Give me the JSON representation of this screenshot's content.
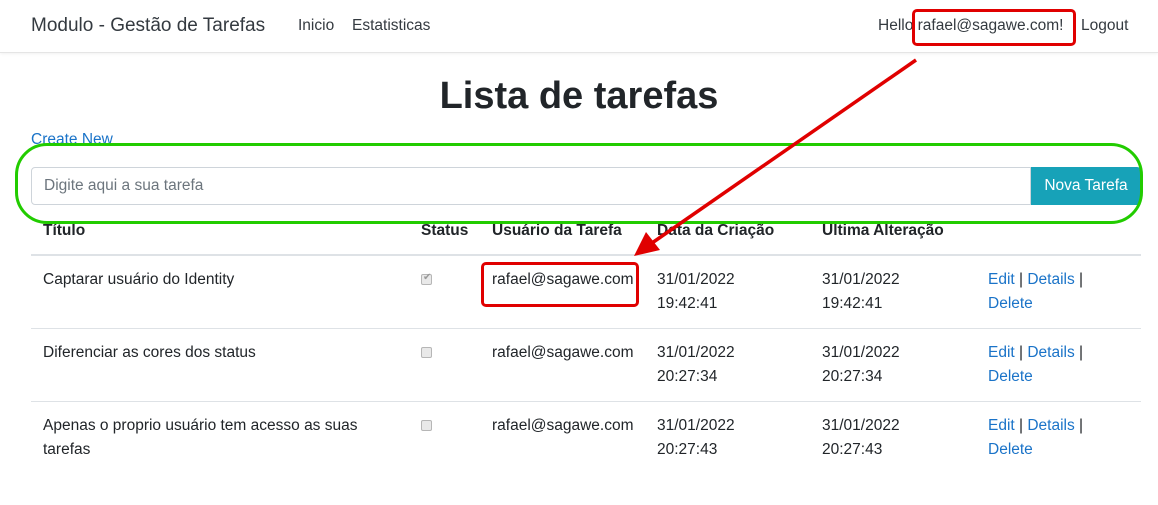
{
  "navbar": {
    "brand": "Modulo - Gestão de Tarefas",
    "links": [
      "Inicio",
      "Estatisticas"
    ],
    "hello_prefix": "Hello ",
    "user_email": "rafael@sagawe.com!",
    "logout": "Logout"
  },
  "page": {
    "title": "Lista de tarefas",
    "create_new": "Create New"
  },
  "form": {
    "placeholder": "Digite aqui a sua tarefa",
    "button": "Nova Tarefa"
  },
  "table": {
    "headers": [
      "Título",
      "Status",
      "Usuário da Tarefa",
      "Data da Criação",
      "Ultima Alteração"
    ],
    "rows": [
      {
        "title": "Captarar usuário do Identity",
        "done": true,
        "user": "rafael@sagawe.com",
        "created_date": "31/01/2022",
        "created_time": "19:42:41",
        "updated_date": "31/01/2022",
        "updated_time": "19:42:41"
      },
      {
        "title": "Diferenciar as cores dos status",
        "done": false,
        "user": "rafael@sagawe.com",
        "created_date": "31/01/2022",
        "created_time": "20:27:34",
        "updated_date": "31/01/2022",
        "updated_time": "20:27:34"
      },
      {
        "title": "Apenas o proprio usuário tem acesso as suas tarefas",
        "done": false,
        "user": "rafael@sagawe.com",
        "created_date": "31/01/2022",
        "created_time": "20:27:43",
        "updated_date": "31/01/2022",
        "updated_time": "20:27:43"
      }
    ],
    "actions": {
      "edit": "Edit",
      "details": "Details",
      "delete": "Delete",
      "sep": " | "
    }
  },
  "colors": {
    "accent_button": "#17a2b8",
    "link": "#1a73c8",
    "annotation_red": "#e00000",
    "annotation_green": "#22cc00"
  }
}
